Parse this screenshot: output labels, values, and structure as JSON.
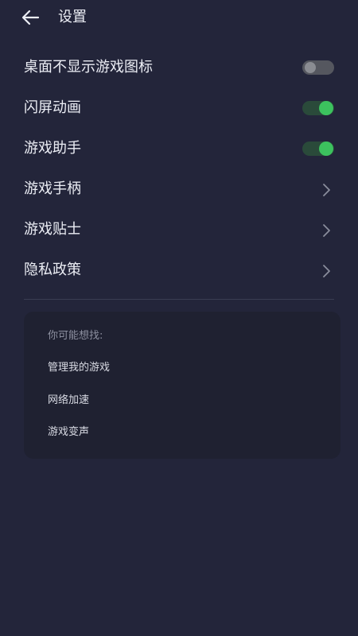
{
  "header": {
    "back_icon": "arrow-left-icon",
    "title": "设置"
  },
  "settings": {
    "items": [
      {
        "label": "桌面不显示游戏图标",
        "control": "toggle",
        "state": "off"
      },
      {
        "label": "闪屏动画",
        "control": "toggle",
        "state": "on"
      },
      {
        "label": "游戏助手",
        "control": "toggle",
        "state": "on"
      },
      {
        "label": "游戏手柄",
        "control": "chevron",
        "icon": "chevron-right-icon"
      },
      {
        "label": "游戏贴士",
        "control": "chevron",
        "icon": "chevron-right-icon"
      },
      {
        "label": "隐私政策",
        "control": "chevron",
        "icon": "chevron-right-icon"
      }
    ]
  },
  "suggestions": {
    "title": "你可能想找:",
    "items": [
      "管理我的游戏",
      "网络加速",
      "游戏变声"
    ]
  },
  "colors": {
    "background": "#23253a",
    "card": "#1f2131",
    "toggle_on": "#3cc25e",
    "toggle_off": "#55575f"
  }
}
